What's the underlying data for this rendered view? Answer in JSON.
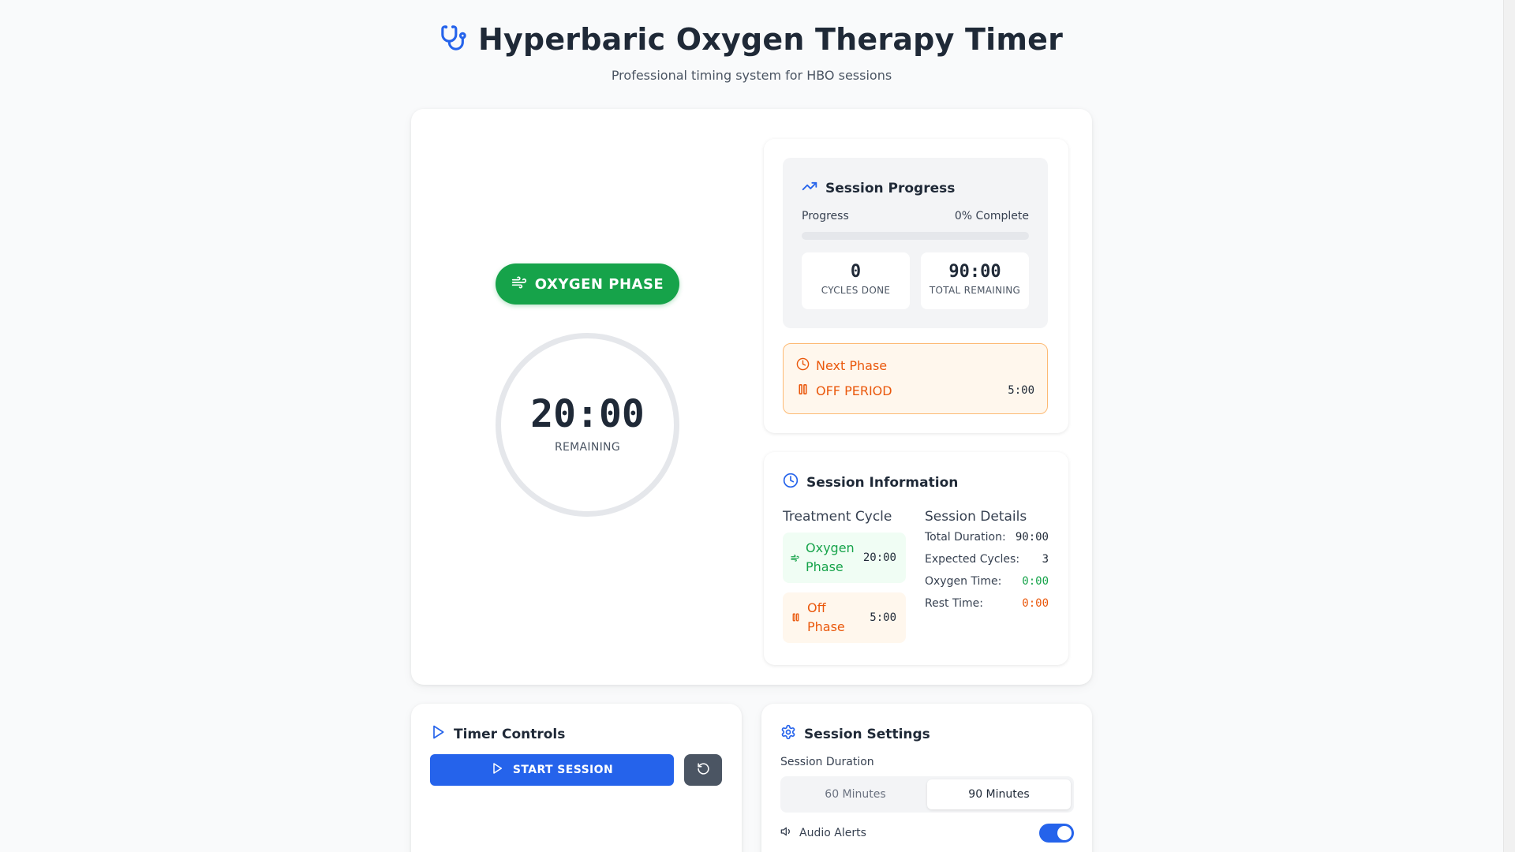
{
  "header": {
    "title": "Hyperbaric Oxygen Therapy Timer",
    "subtitle": "Professional timing system for HBO sessions",
    "icon": "stethoscope-icon"
  },
  "timer": {
    "phase_label": "OXYGEN PHASE",
    "phase_icon": "wind-icon",
    "time": "20:00",
    "remaining_label": "REMAINING"
  },
  "progress": {
    "title": "Session Progress",
    "label": "Progress",
    "percent_text": "0% Complete",
    "percent": 0,
    "cycles_done_value": "0",
    "cycles_done_label": "CYCLES DONE",
    "total_remaining_value": "90:00",
    "total_remaining_label": "TOTAL REMAINING"
  },
  "next_phase": {
    "label": "Next Phase",
    "name": "OFF PERIOD",
    "time": "5:00"
  },
  "session_info": {
    "title": "Session Information",
    "treatment_cycle_heading": "Treatment Cycle",
    "session_details_heading": "Session Details",
    "cycles": [
      {
        "name": "Oxygen Phase",
        "time": "20:00"
      },
      {
        "name": "Off Phase",
        "time": "5:00"
      }
    ],
    "details": [
      {
        "label": "Total Duration:",
        "value": "90:00"
      },
      {
        "label": "Expected Cycles:",
        "value": "3"
      },
      {
        "label": "Oxygen Time:",
        "value": "0:00"
      },
      {
        "label": "Rest Time:",
        "value": "0:00"
      }
    ]
  },
  "controls": {
    "title": "Timer Controls",
    "start_label": "START SESSION"
  },
  "settings": {
    "title": "Session Settings",
    "duration_label": "Session Duration",
    "options": [
      "60 Minutes",
      "90 Minutes"
    ],
    "selected": "90 Minutes",
    "audio_label": "Audio Alerts",
    "audio_enabled": true
  },
  "colors": {
    "primary": "#2563eb",
    "oxygen": "#16a34a",
    "off": "#ea580c"
  }
}
